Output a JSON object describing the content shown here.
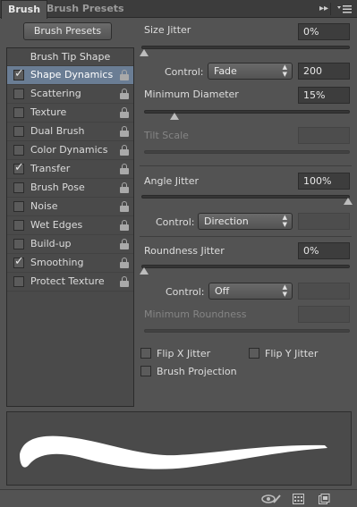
{
  "tabs": {
    "active": "Brush",
    "inactive": "Brush Presets"
  },
  "left": {
    "presets_button": "Brush Presets",
    "tip_shape": "Brush Tip Shape",
    "items": [
      {
        "label": "Shape Dynamics",
        "checked": true,
        "selected": true
      },
      {
        "label": "Scattering",
        "checked": false,
        "selected": false
      },
      {
        "label": "Texture",
        "checked": false,
        "selected": false
      },
      {
        "label": "Dual Brush",
        "checked": false,
        "selected": false
      },
      {
        "label": "Color Dynamics",
        "checked": false,
        "selected": false
      },
      {
        "label": "Transfer",
        "checked": true,
        "selected": false
      },
      {
        "label": "Brush Pose",
        "checked": false,
        "selected": false
      },
      {
        "label": "Noise",
        "checked": false,
        "selected": false
      },
      {
        "label": "Wet Edges",
        "checked": false,
        "selected": false
      },
      {
        "label": "Build-up",
        "checked": false,
        "selected": false
      },
      {
        "label": "Smoothing",
        "checked": true,
        "selected": false
      },
      {
        "label": "Protect Texture",
        "checked": false,
        "selected": false
      }
    ]
  },
  "size_jitter": {
    "label": "Size Jitter",
    "value": "0%",
    "slider": 0
  },
  "control1": {
    "label": "Control:",
    "value": "Fade",
    "number": "200"
  },
  "min_diameter": {
    "label": "Minimum Diameter",
    "value": "15%",
    "slider": 0.15
  },
  "tilt_scale": {
    "label": "Tilt Scale"
  },
  "angle_jitter": {
    "label": "Angle Jitter",
    "value": "100%",
    "slider": 1.0
  },
  "control2": {
    "label": "Control:",
    "value": "Direction"
  },
  "roundness_jitter": {
    "label": "Roundness Jitter",
    "value": "0%",
    "slider": 0
  },
  "control3": {
    "label": "Control:",
    "value": "Off"
  },
  "min_roundness": {
    "label": "Minimum Roundness"
  },
  "options": {
    "flip_x": "Flip X Jitter",
    "flip_y": "Flip Y Jitter",
    "projection": "Brush Projection"
  },
  "icons": {
    "panel_menu": "panel-menu-icon",
    "collapse": "double-arrow-icon",
    "lock": "lock-icon",
    "toggle_preview": "eye-brush-icon",
    "brush_panel": "brush-grid-icon",
    "new_preset": "new-preset-icon"
  },
  "colors": {
    "selected_row": "#6a7d94",
    "panel_bg": "#535353",
    "stroke": "#ffffff"
  }
}
